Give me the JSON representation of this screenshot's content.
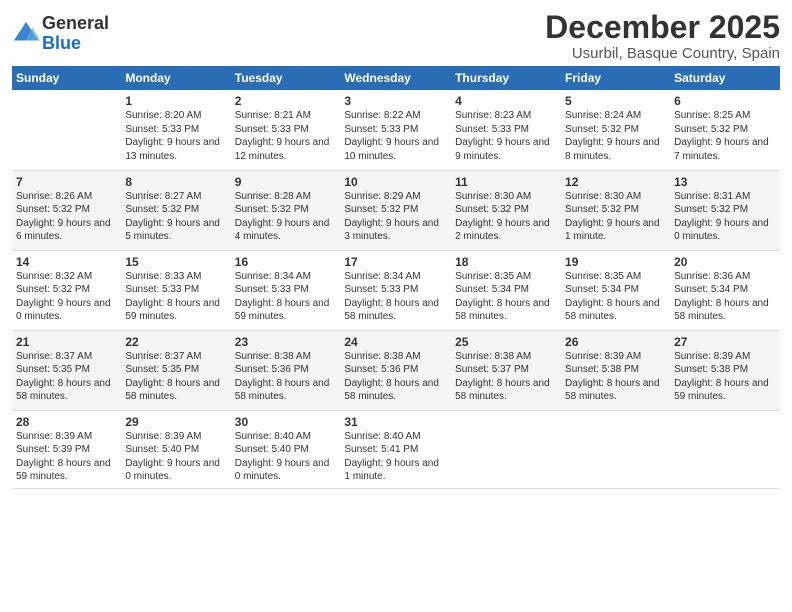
{
  "logo": {
    "general": "General",
    "blue": "Blue"
  },
  "title": "December 2025",
  "location": "Usurbil, Basque Country, Spain",
  "headers": [
    "Sunday",
    "Monday",
    "Tuesday",
    "Wednesday",
    "Thursday",
    "Friday",
    "Saturday"
  ],
  "weeks": [
    [
      {
        "day": "",
        "info": ""
      },
      {
        "day": "1",
        "info": "Sunrise: 8:20 AM\nSunset: 5:33 PM\nDaylight: 9 hours\nand 13 minutes."
      },
      {
        "day": "2",
        "info": "Sunrise: 8:21 AM\nSunset: 5:33 PM\nDaylight: 9 hours\nand 12 minutes."
      },
      {
        "day": "3",
        "info": "Sunrise: 8:22 AM\nSunset: 5:33 PM\nDaylight: 9 hours\nand 10 minutes."
      },
      {
        "day": "4",
        "info": "Sunrise: 8:23 AM\nSunset: 5:33 PM\nDaylight: 9 hours\nand 9 minutes."
      },
      {
        "day": "5",
        "info": "Sunrise: 8:24 AM\nSunset: 5:32 PM\nDaylight: 9 hours\nand 8 minutes."
      },
      {
        "day": "6",
        "info": "Sunrise: 8:25 AM\nSunset: 5:32 PM\nDaylight: 9 hours\nand 7 minutes."
      }
    ],
    [
      {
        "day": "7",
        "info": "Sunrise: 8:26 AM\nSunset: 5:32 PM\nDaylight: 9 hours\nand 6 minutes."
      },
      {
        "day": "8",
        "info": "Sunrise: 8:27 AM\nSunset: 5:32 PM\nDaylight: 9 hours\nand 5 minutes."
      },
      {
        "day": "9",
        "info": "Sunrise: 8:28 AM\nSunset: 5:32 PM\nDaylight: 9 hours\nand 4 minutes."
      },
      {
        "day": "10",
        "info": "Sunrise: 8:29 AM\nSunset: 5:32 PM\nDaylight: 9 hours\nand 3 minutes."
      },
      {
        "day": "11",
        "info": "Sunrise: 8:30 AM\nSunset: 5:32 PM\nDaylight: 9 hours\nand 2 minutes."
      },
      {
        "day": "12",
        "info": "Sunrise: 8:30 AM\nSunset: 5:32 PM\nDaylight: 9 hours\nand 1 minute."
      },
      {
        "day": "13",
        "info": "Sunrise: 8:31 AM\nSunset: 5:32 PM\nDaylight: 9 hours\nand 0 minutes."
      }
    ],
    [
      {
        "day": "14",
        "info": "Sunrise: 8:32 AM\nSunset: 5:32 PM\nDaylight: 9 hours\nand 0 minutes."
      },
      {
        "day": "15",
        "info": "Sunrise: 8:33 AM\nSunset: 5:33 PM\nDaylight: 8 hours\nand 59 minutes."
      },
      {
        "day": "16",
        "info": "Sunrise: 8:34 AM\nSunset: 5:33 PM\nDaylight: 8 hours\nand 59 minutes."
      },
      {
        "day": "17",
        "info": "Sunrise: 8:34 AM\nSunset: 5:33 PM\nDaylight: 8 hours\nand 58 minutes."
      },
      {
        "day": "18",
        "info": "Sunrise: 8:35 AM\nSunset: 5:34 PM\nDaylight: 8 hours\nand 58 minutes."
      },
      {
        "day": "19",
        "info": "Sunrise: 8:35 AM\nSunset: 5:34 PM\nDaylight: 8 hours\nand 58 minutes."
      },
      {
        "day": "20",
        "info": "Sunrise: 8:36 AM\nSunset: 5:34 PM\nDaylight: 8 hours\nand 58 minutes."
      }
    ],
    [
      {
        "day": "21",
        "info": "Sunrise: 8:37 AM\nSunset: 5:35 PM\nDaylight: 8 hours\nand 58 minutes."
      },
      {
        "day": "22",
        "info": "Sunrise: 8:37 AM\nSunset: 5:35 PM\nDaylight: 8 hours\nand 58 minutes."
      },
      {
        "day": "23",
        "info": "Sunrise: 8:38 AM\nSunset: 5:36 PM\nDaylight: 8 hours\nand 58 minutes."
      },
      {
        "day": "24",
        "info": "Sunrise: 8:38 AM\nSunset: 5:36 PM\nDaylight: 8 hours\nand 58 minutes."
      },
      {
        "day": "25",
        "info": "Sunrise: 8:38 AM\nSunset: 5:37 PM\nDaylight: 8 hours\nand 58 minutes."
      },
      {
        "day": "26",
        "info": "Sunrise: 8:39 AM\nSunset: 5:38 PM\nDaylight: 8 hours\nand 58 minutes."
      },
      {
        "day": "27",
        "info": "Sunrise: 8:39 AM\nSunset: 5:38 PM\nDaylight: 8 hours\nand 59 minutes."
      }
    ],
    [
      {
        "day": "28",
        "info": "Sunrise: 8:39 AM\nSunset: 5:39 PM\nDaylight: 8 hours\nand 59 minutes."
      },
      {
        "day": "29",
        "info": "Sunrise: 8:39 AM\nSunset: 5:40 PM\nDaylight: 9 hours\nand 0 minutes."
      },
      {
        "day": "30",
        "info": "Sunrise: 8:40 AM\nSunset: 5:40 PM\nDaylight: 9 hours\nand 0 minutes."
      },
      {
        "day": "31",
        "info": "Sunrise: 8:40 AM\nSunset: 5:41 PM\nDaylight: 9 hours\nand 1 minute."
      },
      {
        "day": "",
        "info": ""
      },
      {
        "day": "",
        "info": ""
      },
      {
        "day": "",
        "info": ""
      }
    ]
  ]
}
